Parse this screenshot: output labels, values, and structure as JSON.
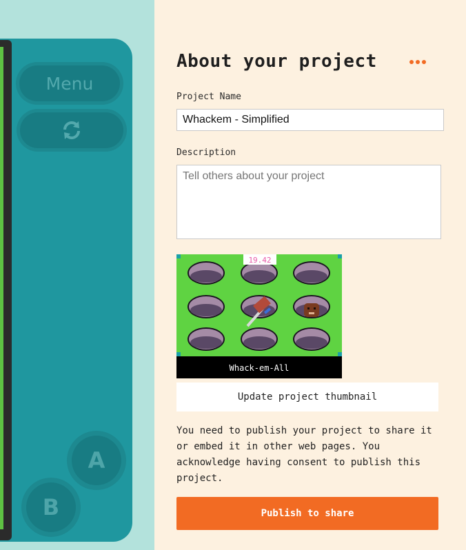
{
  "simulator": {
    "menu_label": "Menu",
    "restart_icon": "refresh-icon",
    "button_a": "A",
    "button_b": "B"
  },
  "panel": {
    "title": "About your project",
    "more_icon": "more-dots-icon",
    "project_name_label": "Project Name",
    "project_name_value": "Whackem - Simplified",
    "description_label": "Description",
    "description_placeholder": "Tell others about your project",
    "thumbnail": {
      "score_text": "19.42",
      "game_title": "Whack-em-All"
    },
    "update_thumbnail_label": "Update project thumbnail",
    "notice_text": "You need to publish your project to share it or embed it in other web pages. You acknowledge having consent to publish this project.",
    "publish_label": "Publish to share"
  },
  "colors": {
    "accent": "#f26b23",
    "panel_bg": "#fdf1e0",
    "console": "#1f979f",
    "backdrop": "#b3e2dc",
    "game_grass": "#5fd342"
  }
}
